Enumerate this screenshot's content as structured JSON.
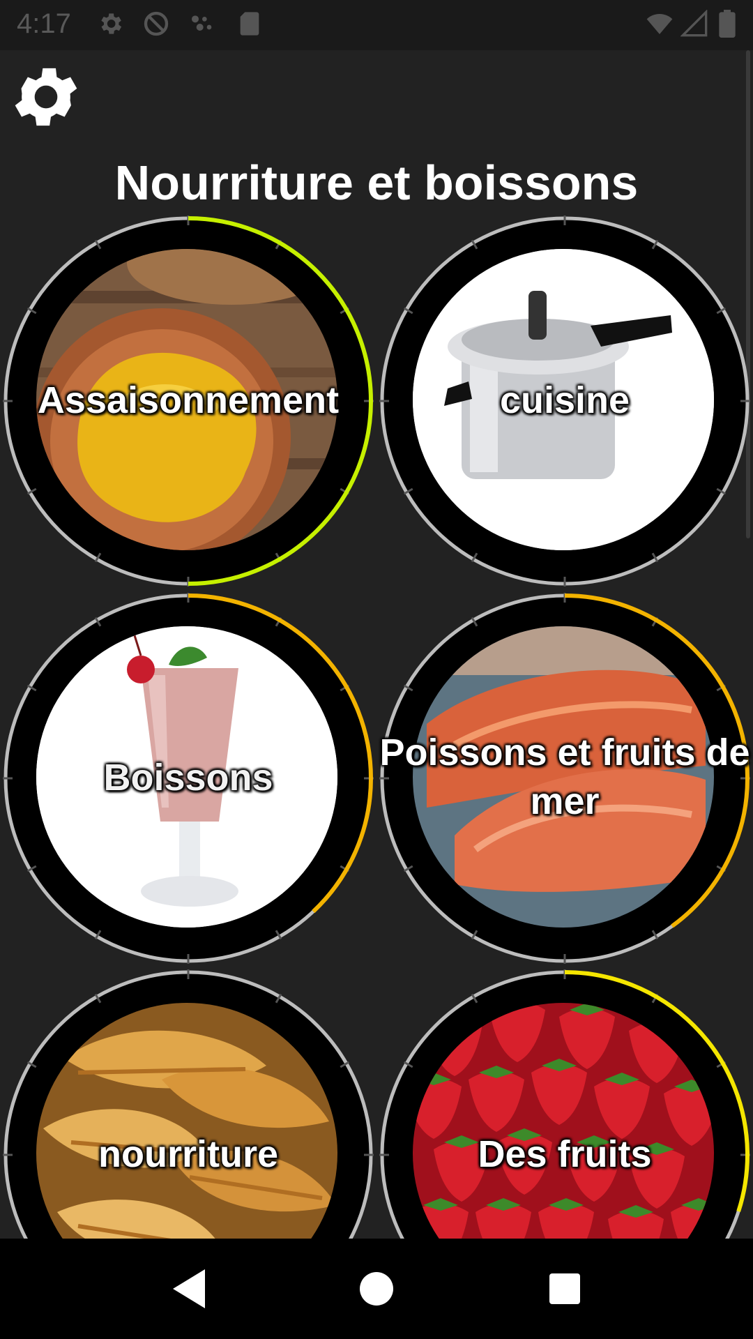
{
  "status_bar": {
    "time": "4:17",
    "icons_left": [
      "gear-icon",
      "do-not-disturb-icon",
      "dots-icon",
      "sd-card-icon"
    ],
    "icons_right": [
      "wifi-icon",
      "signal-icon",
      "battery-icon"
    ]
  },
  "header": {
    "settings_icon": "gear-icon",
    "title": "Nourriture et boissons"
  },
  "categories": [
    {
      "label": "Assaisonnement",
      "progress": 0.5,
      "ring_color": "#c6f000"
    },
    {
      "label": "cuisine",
      "progress": 0,
      "ring_color": "#c8c8c8"
    },
    {
      "label": "Boissons",
      "progress": 0.38,
      "ring_color": "#f3b300"
    },
    {
      "label": "Poissons et fruits de mer",
      "progress": 0.4,
      "ring_color": "#f3b300"
    },
    {
      "label": "nourriture",
      "progress": 0,
      "ring_color": "#c8c8c8"
    },
    {
      "label": "Des fruits",
      "progress": 0.3,
      "ring_color": "#f5e600"
    }
  ],
  "nav_bar": {
    "back_icon": "back-triangle-icon",
    "home_icon": "home-circle-icon",
    "recents_icon": "recents-square-icon"
  }
}
